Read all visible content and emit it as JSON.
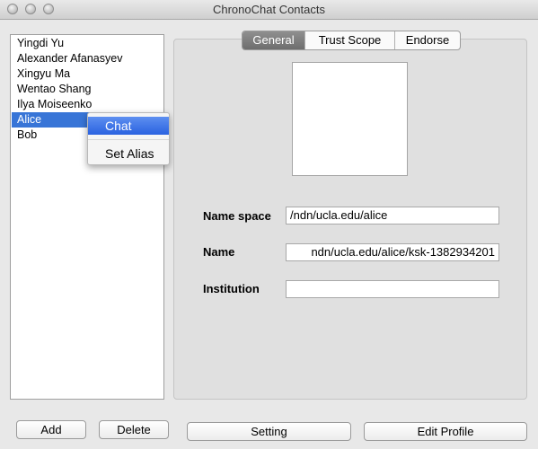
{
  "window": {
    "title": "ChronoChat Contacts"
  },
  "contacts": [
    {
      "name": "Yingdi Yu",
      "selected": false
    },
    {
      "name": "Alexander Afanasyev",
      "selected": false
    },
    {
      "name": "Xingyu Ma",
      "selected": false
    },
    {
      "name": "Wentao Shang",
      "selected": false
    },
    {
      "name": "Ilya Moiseenko",
      "selected": false
    },
    {
      "name": "Alice",
      "selected": true
    },
    {
      "name": "Bob",
      "selected": false
    }
  ],
  "context_menu": {
    "items": [
      {
        "label": "Chat",
        "highlighted": true
      },
      {
        "label": "Set Alias",
        "highlighted": false
      }
    ]
  },
  "tabs": [
    {
      "label": "General",
      "active": true
    },
    {
      "label": "Trust Scope",
      "active": false
    },
    {
      "label": "Endorse",
      "active": false
    }
  ],
  "profile": {
    "name_space_label": "Name space",
    "name_space_value": "/ndn/ucla.edu/alice",
    "name_label": "Name",
    "name_value": "ndn/ucla.edu/alice/ksk-1382934201",
    "institution_label": "Institution",
    "institution_value": ""
  },
  "buttons": {
    "add": "Add",
    "delete": "Delete",
    "setting": "Setting",
    "edit_profile": "Edit Profile"
  }
}
